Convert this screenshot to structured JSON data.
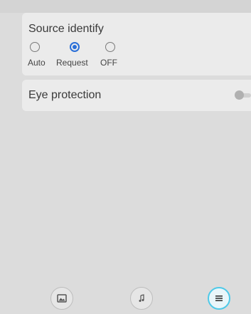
{
  "source_identify": {
    "title": "Source identify",
    "options": [
      {
        "label": "Auto",
        "selected": false
      },
      {
        "label": "Request",
        "selected": true
      },
      {
        "label": "OFF",
        "selected": false
      }
    ]
  },
  "eye_protection": {
    "title": "Eye protection",
    "enabled": false
  },
  "bottom_nav": {
    "items": [
      {
        "icon": "image-icon",
        "active": false
      },
      {
        "icon": "music-icon",
        "active": false
      },
      {
        "icon": "menu-icon",
        "active": true
      }
    ]
  },
  "colors": {
    "accent": "#2a6fd8",
    "active_ring": "#4ec9e8"
  }
}
